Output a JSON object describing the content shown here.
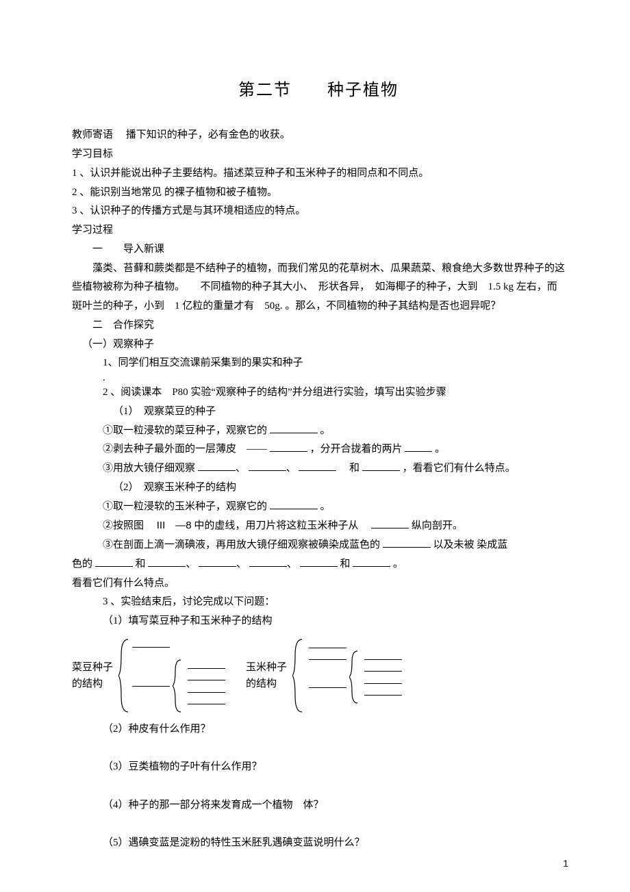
{
  "title": "第二节　　种子植物",
  "teacher_note_label": "教师寄语",
  "teacher_note": "播下知识的种子，必有金色的收获。",
  "obj_header": "学习目标",
  "obj1": "1 、认识并能说出种子主要结构。描述菜豆种子和玉米种子的相同点和不同点。",
  "obj2": "2 、能识别当地常见 的裸子植物和被子植物。",
  "obj3": "3 、认识种子的传播方式是与其环境相适应的特点。",
  "proc_header": "学习过程",
  "sec1": "一　　导入新课",
  "p1": "藻类、苔藓和蕨类都是不结种子的植物，而我们常见的花草树木、瓜果蔬菜、粮食绝大多数世界种子的这些植物被称为种子植物。　　不同植物的种子其大小、　形状各异，　如海椰子的种子，大到　1.5 kg 左右，而斑叶兰的种子，小到　1 亿粒的重量才有　50g. 。那么，不同植物的种子其结构是否也迥异呢？",
  "sec2": "二　合作探究",
  "sub1": "（一）观察种子",
  "q1": "1、同学们相互交流课前采集到的果实和种子",
  "q2": "2 、阅读课本　P80 实验“观察种子的结构”并分组进行实验，填写出实验步骤",
  "q2_1": "（1）　观察菜豆的种子",
  "q2_1a": "①取一粒浸软的菜豆种子，观察它的",
  "q2_1a_end": "。",
  "q2_1b_a": "②剥去种子最外面的一层薄皮　——",
  "q2_1b_b": "，分开合拢着的两片",
  "q2_1b_c": "。",
  "q2_1c_a": "③用放大镜仔细观察",
  "q2_1c_and": "　和",
  "q2_1c_end": "，看看它们有什么特点。",
  "q2_2": "（2）　观察玉米种子的结构",
  "q2_2a": "①取一粒浸软的玉米种子，观察它的",
  "q2_2a_end": "。",
  "q2_2b_a": "②按照图　",
  "q2_2b_b": "III　—8",
  "q2_2b_c": " 中的虚线，用刀片将这粒玉米种子从　",
  "q2_2b_d": "纵向剖开。",
  "q2_2c_a": "③在剖面上滴一滴碘液，再用放大镜仔细观察被碘染成蓝色的",
  "q2_2c_b": "以及未被 染成蓝",
  "q2_2c_c": "色的",
  "q2_2c_and": "和",
  "q2_2c_end": "。",
  "q2_2c_last": "看看它们有什么特点。",
  "q3": "3 、实验结束后，讨论完成以下问题：",
  "q3_1": "（1）填写菜豆种子和玉米种子的结构",
  "diag_left_label_a": "菜豆种子",
  "diag_left_label_b": "的结构",
  "diag_right_label_a": "玉米种子",
  "diag_right_label_b": "的结构",
  "q3_2": "（2）种皮有什么作用？",
  "q3_3": "（3）豆类植物的子叶有什么作用？",
  "q3_4": "（4）种子的那一部分将来发育成一个植物　体？",
  "q3_5": "（5）遇碘变蓝是淀粉的特性玉米胚乳遇碘变蓝说明什么？",
  "page_number": "1"
}
